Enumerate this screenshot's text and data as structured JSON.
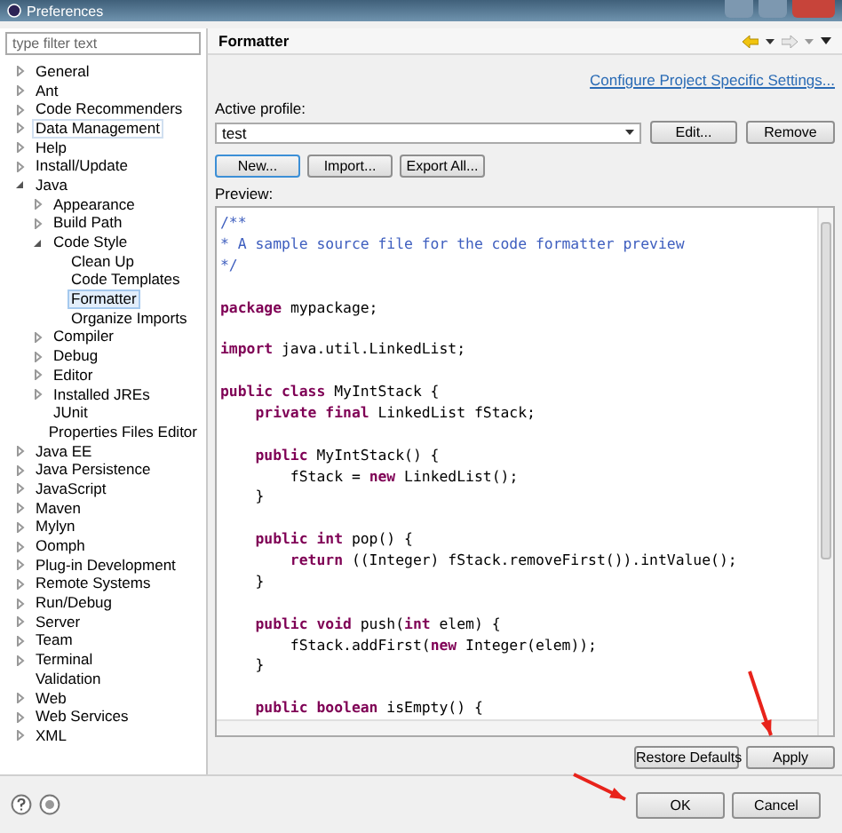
{
  "window": {
    "title": "Preferences"
  },
  "filter": {
    "placeholder": "type filter text"
  },
  "tree": [
    {
      "label": "General",
      "expanded": false,
      "selected": false,
      "hovered": false
    },
    {
      "label": "Ant",
      "expanded": false,
      "selected": false,
      "hovered": false
    },
    {
      "label": "Code Recommenders",
      "expanded": false,
      "selected": false,
      "hovered": false
    },
    {
      "label": "Data Management",
      "expanded": false,
      "selected": false,
      "hovered": true
    },
    {
      "label": "Help",
      "expanded": false,
      "selected": false,
      "hovered": false
    },
    {
      "label": "Install/Update",
      "expanded": false,
      "selected": false,
      "hovered": false
    },
    {
      "label": "Java",
      "expanded": true,
      "selected": false,
      "hovered": false,
      "children": [
        {
          "label": "Appearance",
          "expanded": false,
          "selected": false,
          "hovered": false
        },
        {
          "label": "Build Path",
          "expanded": false,
          "selected": false,
          "hovered": false
        },
        {
          "label": "Code Style",
          "expanded": true,
          "selected": false,
          "hovered": false,
          "children": [
            {
              "label": "Clean Up",
              "selected": false,
              "hovered": false
            },
            {
              "label": "Code Templates",
              "selected": false,
              "hovered": false
            },
            {
              "label": "Formatter",
              "selected": true,
              "hovered": false
            },
            {
              "label": "Organize Imports",
              "selected": false,
              "hovered": false
            }
          ]
        },
        {
          "label": "Compiler",
          "expanded": false,
          "selected": false,
          "hovered": false
        },
        {
          "label": "Debug",
          "expanded": false,
          "selected": false,
          "hovered": false
        },
        {
          "label": "Editor",
          "expanded": false,
          "selected": false,
          "hovered": false
        },
        {
          "label": "Installed JREs",
          "expanded": false,
          "selected": false,
          "hovered": false
        },
        {
          "label": "JUnit",
          "selected": false,
          "hovered": false
        },
        {
          "label": "Properties Files Editor",
          "selected": false,
          "hovered": false
        }
      ]
    },
    {
      "label": "Java EE",
      "expanded": false,
      "selected": false,
      "hovered": false
    },
    {
      "label": "Java Persistence",
      "expanded": false,
      "selected": false,
      "hovered": false
    },
    {
      "label": "JavaScript",
      "expanded": false,
      "selected": false,
      "hovered": false
    },
    {
      "label": "Maven",
      "expanded": false,
      "selected": false,
      "hovered": false
    },
    {
      "label": "Mylyn",
      "expanded": false,
      "selected": false,
      "hovered": false
    },
    {
      "label": "Oomph",
      "expanded": false,
      "selected": false,
      "hovered": false
    },
    {
      "label": "Plug-in Development",
      "expanded": false,
      "selected": false,
      "hovered": false
    },
    {
      "label": "Remote Systems",
      "expanded": false,
      "selected": false,
      "hovered": false
    },
    {
      "label": "Run/Debug",
      "expanded": false,
      "selected": false,
      "hovered": false
    },
    {
      "label": "Server",
      "expanded": false,
      "selected": false,
      "hovered": false
    },
    {
      "label": "Team",
      "expanded": false,
      "selected": false,
      "hovered": false
    },
    {
      "label": "Terminal",
      "expanded": false,
      "selected": false,
      "hovered": false
    },
    {
      "label": "Validation",
      "selected": false,
      "hovered": false
    },
    {
      "label": "Web",
      "expanded": false,
      "selected": false,
      "hovered": false
    },
    {
      "label": "Web Services",
      "expanded": false,
      "selected": false,
      "hovered": false
    },
    {
      "label": "XML",
      "expanded": false,
      "selected": false,
      "hovered": false
    }
  ],
  "page": {
    "title": "Formatter",
    "link": "Configure Project Specific Settings...",
    "profile_label": "Active profile:",
    "profile": "test",
    "profile_buttons": [
      "Edit...",
      "Remove"
    ],
    "buttons": [
      {
        "label": "New...",
        "selected": true
      },
      {
        "label": "Import...",
        "selected": false
      },
      {
        "label": "Export All...",
        "selected": false
      }
    ],
    "preview_label": "Preview:",
    "code": [
      {
        "kind": "code",
        "segments": [
          {
            "text": "/**",
            "kind": "comment"
          }
        ]
      },
      {
        "kind": "code",
        "segments": [
          {
            "text": "* A sample source file for the code formatter preview",
            "kind": "comment"
          }
        ]
      },
      {
        "kind": "code",
        "segments": [
          {
            "text": "*/",
            "kind": "comment"
          }
        ]
      },
      {
        "kind": "blank"
      },
      {
        "kind": "code",
        "segments": [
          {
            "text": "package",
            "kind": "keyword"
          },
          {
            "text": " mypackage;",
            "kind": "plain"
          }
        ]
      },
      {
        "kind": "blank"
      },
      {
        "kind": "code",
        "segments": [
          {
            "text": "import",
            "kind": "keyword"
          },
          {
            "text": " java.util.LinkedList;",
            "kind": "plain"
          }
        ]
      },
      {
        "kind": "blank"
      },
      {
        "kind": "code",
        "segments": [
          {
            "text": "public class",
            "kind": "keyword"
          },
          {
            "text": " MyIntStack {",
            "kind": "plain"
          }
        ]
      },
      {
        "kind": "code",
        "segments": [
          {
            "text": "    private final",
            "kind": "keyword"
          },
          {
            "text": " LinkedList fStack;",
            "kind": "plain"
          }
        ]
      },
      {
        "kind": "blank"
      },
      {
        "kind": "code",
        "segments": [
          {
            "text": "    public",
            "kind": "keyword"
          },
          {
            "text": " MyIntStack() {",
            "kind": "plain"
          }
        ]
      },
      {
        "kind": "code",
        "segments": [
          {
            "text": "        fStack = ",
            "kind": "plain"
          },
          {
            "text": "new",
            "kind": "keyword"
          },
          {
            "text": " LinkedList();",
            "kind": "plain"
          }
        ]
      },
      {
        "kind": "code",
        "segments": [
          {
            "text": "    }",
            "kind": "plain"
          }
        ]
      },
      {
        "kind": "blank"
      },
      {
        "kind": "code",
        "segments": [
          {
            "text": "    public int",
            "kind": "keyword"
          },
          {
            "text": " pop() {",
            "kind": "plain"
          }
        ]
      },
      {
        "kind": "code",
        "segments": [
          {
            "text": "        return",
            "kind": "keyword"
          },
          {
            "text": " ((Integer) fStack.removeFirst()).intValue();",
            "kind": "plain"
          }
        ]
      },
      {
        "kind": "code",
        "segments": [
          {
            "text": "    }",
            "kind": "plain"
          }
        ]
      },
      {
        "kind": "blank"
      },
      {
        "kind": "code",
        "segments": [
          {
            "text": "    public void",
            "kind": "keyword"
          },
          {
            "text": " push(",
            "kind": "plain"
          },
          {
            "text": "int",
            "kind": "keyword"
          },
          {
            "text": " elem) {",
            "kind": "plain"
          }
        ]
      },
      {
        "kind": "code",
        "segments": [
          {
            "text": "        fStack.addFirst(",
            "kind": "plain"
          },
          {
            "text": "new",
            "kind": "keyword"
          },
          {
            "text": " Integer(elem));",
            "kind": "plain"
          }
        ]
      },
      {
        "kind": "code",
        "segments": [
          {
            "text": "    }",
            "kind": "plain"
          }
        ]
      },
      {
        "kind": "blank"
      },
      {
        "kind": "code",
        "segments": [
          {
            "text": "    public boolean",
            "kind": "keyword"
          },
          {
            "text": " isEmpty() {",
            "kind": "plain"
          }
        ]
      }
    ],
    "page_buttons": [
      "Restore Defaults",
      "Apply"
    ]
  },
  "dialog_buttons": [
    "OK",
    "Cancel"
  ]
}
